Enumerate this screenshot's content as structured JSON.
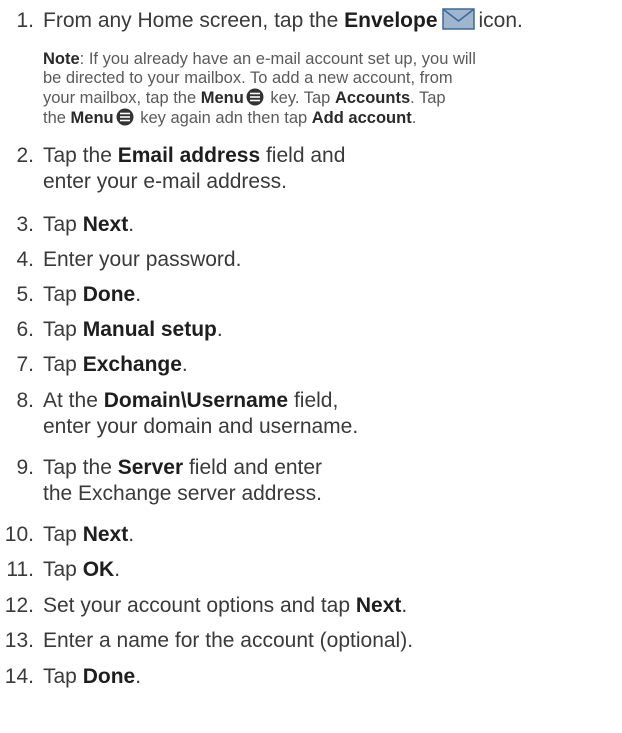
{
  "steps": [
    {
      "num": "1.",
      "parts": [
        {
          "t": "From any Home screen, tap the ",
          "b": false
        },
        {
          "t": "Envelope",
          "b": true
        },
        {
          "icon": "envelope-icon"
        },
        {
          "t": "icon.",
          "b": false
        }
      ]
    },
    {
      "num": "2.",
      "lines": [
        [
          {
            "t": "Tap the ",
            "b": false
          },
          {
            "t": "Email address",
            "b": true
          },
          {
            "t": " field and",
            "b": false
          }
        ],
        [
          {
            "t": "enter your e-mail address.",
            "b": false
          }
        ]
      ]
    },
    {
      "num": "3.",
      "parts": [
        {
          "t": "Tap ",
          "b": false
        },
        {
          "t": "Next",
          "b": true
        },
        {
          "t": ".",
          "b": false
        }
      ]
    },
    {
      "num": "4.",
      "parts": [
        {
          "t": "Enter your password.",
          "b": false
        }
      ]
    },
    {
      "num": "5.",
      "parts": [
        {
          "t": "Tap ",
          "b": false
        },
        {
          "t": "Done",
          "b": true
        },
        {
          "t": ".",
          "b": false
        }
      ]
    },
    {
      "num": "6.",
      "parts": [
        {
          "t": "Tap ",
          "b": false
        },
        {
          "t": "Manual setup",
          "b": true
        },
        {
          "t": ".",
          "b": false
        }
      ]
    },
    {
      "num": "7.",
      "parts": [
        {
          "t": "Tap ",
          "b": false
        },
        {
          "t": "Exchange",
          "b": true
        },
        {
          "t": ".",
          "b": false
        }
      ]
    },
    {
      "num": "8.",
      "lines": [
        [
          {
            "t": "At the ",
            "b": false
          },
          {
            "t": "Domain\\Username",
            "b": true
          },
          {
            "t": " field,",
            "b": false
          }
        ],
        [
          {
            "t": "enter your domain and username.",
            "b": false
          }
        ]
      ]
    },
    {
      "num": "9.",
      "lines": [
        [
          {
            "t": "Tap the ",
            "b": false
          },
          {
            "t": "Server",
            "b": true
          },
          {
            "t": " field and enter",
            "b": false
          }
        ],
        [
          {
            "t": "the Exchange server address.",
            "b": false
          }
        ]
      ]
    },
    {
      "num": "10.",
      "parts": [
        {
          "t": "Tap ",
          "b": false
        },
        {
          "t": "Next",
          "b": true
        },
        {
          "t": ".",
          "b": false
        }
      ]
    },
    {
      "num": "11.",
      "parts": [
        {
          "t": "Tap ",
          "b": false
        },
        {
          "t": "OK",
          "b": true
        },
        {
          "t": ".",
          "b": false
        }
      ]
    },
    {
      "num": "12.",
      "parts": [
        {
          "t": "Set your account options and tap ",
          "b": false
        },
        {
          "t": "Next",
          "b": true
        },
        {
          "t": ".",
          "b": false
        }
      ]
    },
    {
      "num": "13.",
      "parts": [
        {
          "t": "Enter a name for the account (optional).",
          "b": false
        }
      ]
    },
    {
      "num": "14.",
      "parts": [
        {
          "t": "Tap ",
          "b": false
        },
        {
          "t": "Done",
          "b": true
        },
        {
          "t": ".",
          "b": false
        }
      ]
    }
  ],
  "note": [
    [
      {
        "t": "Note",
        "b": true
      },
      {
        "t": ": If you already have an e-mail account set up, you will",
        "b": false
      }
    ],
    [
      {
        "t": "be directed to your mailbox. To add a new account, from",
        "b": false
      }
    ],
    [
      {
        "t": "your mailbox, tap the ",
        "b": false
      },
      {
        "t": "Menu",
        "b": true
      },
      {
        "icon": "menu-icon"
      },
      {
        "t": " key. Tap ",
        "b": false
      },
      {
        "t": "Accounts",
        "b": true
      },
      {
        "t": ". Tap",
        "b": false
      }
    ],
    [
      {
        "t": "the ",
        "b": false
      },
      {
        "t": "Menu",
        "b": true
      },
      {
        "icon": "menu-icon"
      },
      {
        "t": " key again adn then tap ",
        "b": false
      },
      {
        "t": "Add account",
        "b": true
      },
      {
        "t": ".",
        "b": false
      }
    ]
  ],
  "colors": {
    "text": "#3a3a3a",
    "note_text": "#5a5a5a",
    "envelope_fill": "#9fb6d0",
    "envelope_stroke": "#3f6896",
    "menu_icon": "#333333"
  }
}
